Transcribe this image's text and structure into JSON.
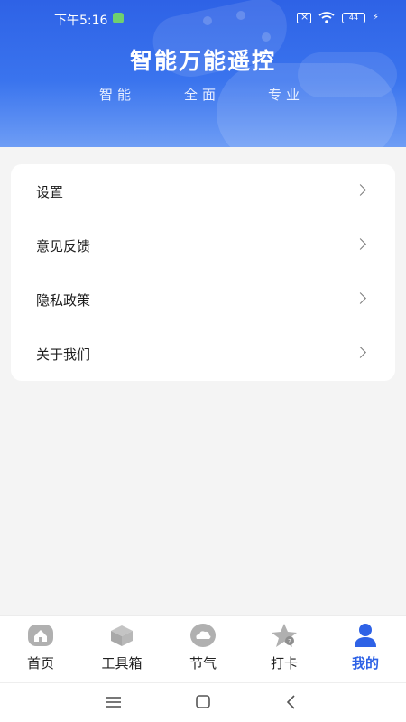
{
  "status_bar": {
    "time": "下午5:16",
    "battery": "44"
  },
  "header": {
    "title": "智能万能遥控",
    "subtitles": [
      "智能",
      "全面",
      "专业"
    ]
  },
  "menu": {
    "items": [
      {
        "label": "设置"
      },
      {
        "label": "意见反馈"
      },
      {
        "label": "隐私政策"
      },
      {
        "label": "关于我们"
      }
    ]
  },
  "tabbar": {
    "tabs": [
      {
        "label": "首页",
        "icon": "home-icon",
        "active": false
      },
      {
        "label": "工具箱",
        "icon": "toolbox-icon",
        "active": false
      },
      {
        "label": "节气",
        "icon": "cloud-icon",
        "active": false
      },
      {
        "label": "打卡",
        "icon": "star-icon",
        "active": false
      },
      {
        "label": "我的",
        "icon": "user-icon",
        "active": true
      }
    ],
    "active_color": "#2e62e6",
    "inactive_icon_color": "#b0b0b0"
  },
  "colors": {
    "accent": "#2e62e6",
    "background": "#f4f4f4"
  }
}
